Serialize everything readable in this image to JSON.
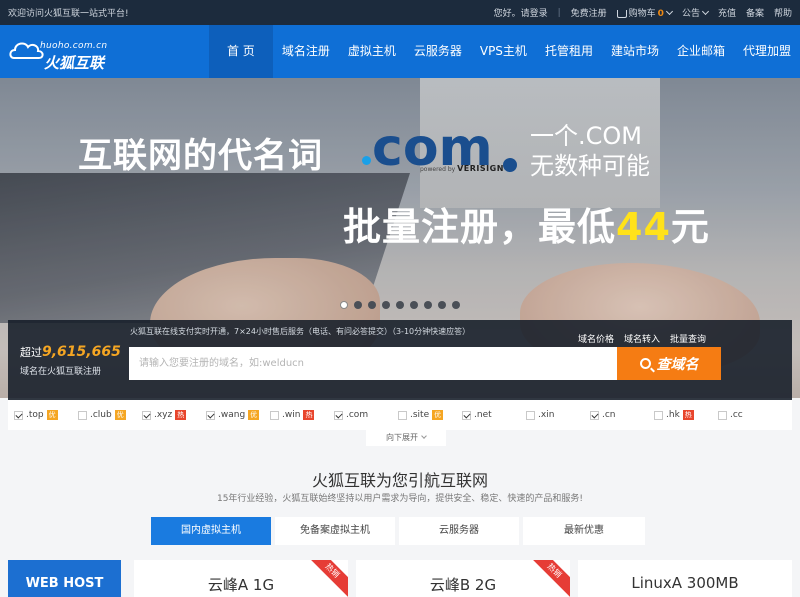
{
  "topbar": {
    "welcome": "欢迎访问火狐互联一站式平台!",
    "greeting": "您好。请登录",
    "register": "免费注册",
    "cart_label": "购物车",
    "cart_count": "0",
    "notice": "公告",
    "recharge": "充值",
    "filing": "备案",
    "help": "帮助"
  },
  "logo": {
    "domain": "huoho.com.cn",
    "name": "火狐互联"
  },
  "nav": {
    "items": [
      "首 页",
      "域名注册",
      "虚拟主机",
      "云服务器",
      "VPS主机",
      "托管租用",
      "建站市场",
      "企业邮箱",
      "代理加盟"
    ]
  },
  "banner": {
    "headline": "互联网的代名词",
    "dotcom": "com",
    "powered": "powered by",
    "verisign": "VERISIGN",
    "sub1": "一个.COM",
    "sub2": "无数种可能",
    "promo_pre": "批量注册，最低",
    "promo_price": "44",
    "promo_post": "元"
  },
  "carousel": {
    "count": 9,
    "active": 1
  },
  "search": {
    "prefix": "超过",
    "count": "9,615,665",
    "desc": "域名在火狐互联注册",
    "notice": "火狐互联在线支付实时开通，7×24小时售后服务（电话、有问必答提交）（3-10分钟快速应答）",
    "links": [
      "域名价格",
      "域名转入",
      "批量查询"
    ],
    "placeholder": "请输入您要注册的域名，如:welducn",
    "button": "查域名"
  },
  "tlds": [
    {
      "name": ".top",
      "checked": true,
      "badge": "优",
      "badge_type": "offer"
    },
    {
      "name": ".club",
      "checked": false,
      "badge": "优",
      "badge_type": "offer"
    },
    {
      "name": ".xyz",
      "checked": true,
      "badge": "热",
      "badge_type": "hot"
    },
    {
      "name": ".wang",
      "checked": true,
      "badge": "优",
      "badge_type": "offer"
    },
    {
      "name": ".win",
      "checked": false,
      "badge": "热",
      "badge_type": "hot"
    },
    {
      "name": ".com",
      "checked": true,
      "badge": "",
      "badge_type": ""
    },
    {
      "name": ".site",
      "checked": false,
      "badge": "优",
      "badge_type": "offer"
    },
    {
      "name": ".net",
      "checked": true,
      "badge": "",
      "badge_type": ""
    },
    {
      "name": ".xin",
      "checked": false,
      "badge": "",
      "badge_type": ""
    },
    {
      "name": ".cn",
      "checked": true,
      "badge": "",
      "badge_type": ""
    },
    {
      "name": ".hk",
      "checked": false,
      "badge": "热",
      "badge_type": "hot"
    },
    {
      "name": ".cc",
      "checked": false,
      "badge": "",
      "badge_type": ""
    }
  ],
  "expand_label": "向下展开",
  "section": {
    "title": "火狐互联为您引航互联网",
    "subtitle": "15年行业经验，火狐互联始终坚持以用户需求为导向，提供安全、稳定、快速的产品和服务!"
  },
  "tabs": [
    "国内虚拟主机",
    "免备案虚拟主机",
    "云服务器",
    "最新优惠"
  ],
  "products": {
    "label": "WEB HOST",
    "cards": [
      {
        "name": "云峰A 1G",
        "ribbon": "热销"
      },
      {
        "name": "云峰B 2G",
        "ribbon": "热销"
      },
      {
        "name": "LinuxA 300MB",
        "ribbon": ""
      }
    ]
  },
  "colors": {
    "nav": "#0f6fd6",
    "accent": "#f57c13",
    "price": "#ffe21a",
    "hot": "#e8452c"
  }
}
